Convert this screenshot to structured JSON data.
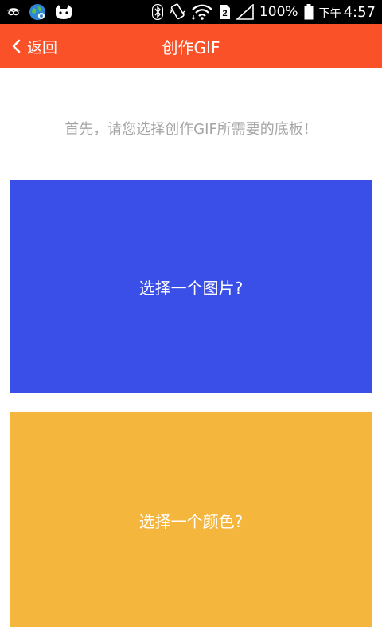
{
  "status_bar": {
    "time_ampm": "下午",
    "time": "4:57",
    "battery_percent": "100%",
    "icons": [
      "eye-mask-icon",
      "globe-icon",
      "cat-icon",
      "bluetooth-icon",
      "vibrate-icon",
      "wifi-icon",
      "sim-icon",
      "signal-icon",
      "battery-icon"
    ]
  },
  "app_bar": {
    "back_label": "返回",
    "title": "创作GIF",
    "background": "#fa5128"
  },
  "main": {
    "prompt": "首先，请您选择创作GIF所需要的底板！",
    "cards": [
      {
        "label": "选择一个图片?",
        "color": "#3a4fe8"
      },
      {
        "label": "选择一个颜色?",
        "color": "#f5b63d"
      }
    ]
  }
}
